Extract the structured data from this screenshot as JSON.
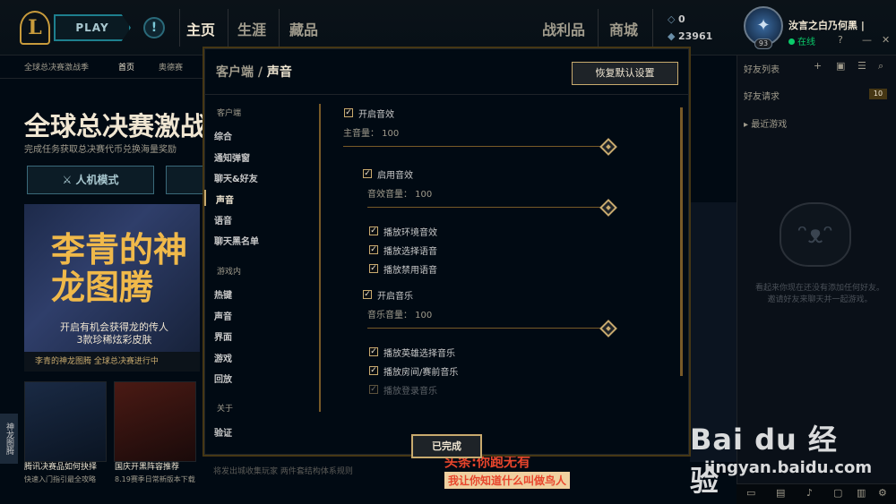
{
  "topbar": {
    "logo": "L",
    "play_label": "PLAY",
    "alert_label": "!",
    "nav": [
      "主页",
      "生涯",
      "藏品",
      "战利品",
      "商城"
    ],
    "blue_essence": "0",
    "riot_points": "23961",
    "summoner_name": "汝言之白乃何黑 |",
    "status": "在线",
    "level": "93",
    "window_controls": [
      "?",
      "—",
      "✕"
    ]
  },
  "subnav": [
    "全球总决赛激战季",
    "首页",
    "奥德赛"
  ],
  "background": {
    "hero_title": "全球总决赛激战季",
    "hero_sub": "完成任务获取总决赛代币兑换海量奖励",
    "mode_button": "人机模式",
    "banner_title": "李青的神龙图腾",
    "banner_sub": "开启有机会获得龙的传人\n3款珍稀炫彩皮肤",
    "banner_tabs": "李青的神龙图腾   全球总决赛进行中",
    "thumbs": [
      {
        "cap": "腾讯决赛品如何抉择",
        "cap2": "快速入门指引最全攻略"
      },
      {
        "cap": "国庆开黑阵容推荐",
        "cap2": "8.19赛季日常新版本下载"
      }
    ],
    "side_tab": "神龙图腾",
    "news_bottom": "将发出城收集玩家 两件套结构体系规则",
    "promo": "头条:你跑无有",
    "promo2": "我让你知道什么叫做鸟人"
  },
  "friends": {
    "header": "好友列表",
    "requests_label": "好友请求",
    "requests_count": "10",
    "recent_label": "▸ 最近游戏",
    "empty_text": "看起来你现在还没有添加任何好友。邀请好友来聊天并一起游戏。"
  },
  "modal": {
    "title_parent": "客户端",
    "title_sep": " / ",
    "title_current": "声音",
    "reset_label": "恢复默认设置",
    "done_label": "已完成",
    "sidebar": {
      "group_client": "客户端",
      "client_items": [
        "综合",
        "通知弹窗",
        "聊天&好友",
        "声音",
        "语音",
        "聊天黑名单"
      ],
      "group_ingame": "游戏内",
      "ingame_items": [
        "热键",
        "声音",
        "界面",
        "游戏",
        "回放"
      ],
      "group_about": "关于",
      "about_items": [
        "验证"
      ]
    },
    "settings": {
      "enable_sfx": "开启音效",
      "master_volume": "主音量： 100",
      "enable_audio": "启用音效",
      "sfx_volume": "音效音量： 100",
      "ambient": "播放环境音效",
      "pick_voice": "播放选择语音",
      "ban_voice": "播放禁用语音",
      "enable_music": "开启音乐",
      "music_volume": "音乐音量： 100",
      "champ_select_music": "播放英雄选择音乐",
      "lobby_music": "播放房间/赛前音乐",
      "login_music": "播放登录音乐"
    },
    "volumes": {
      "master": 100,
      "sfx": 100,
      "music": 100
    }
  },
  "watermark": {
    "logo": "Bai du 经验",
    "url": "jingyan.baidu.com"
  },
  "colors": {
    "gold": "#c8aa6e",
    "dark_gold": "#785a28",
    "bg": "#010a13",
    "online": "#0acb6a"
  }
}
